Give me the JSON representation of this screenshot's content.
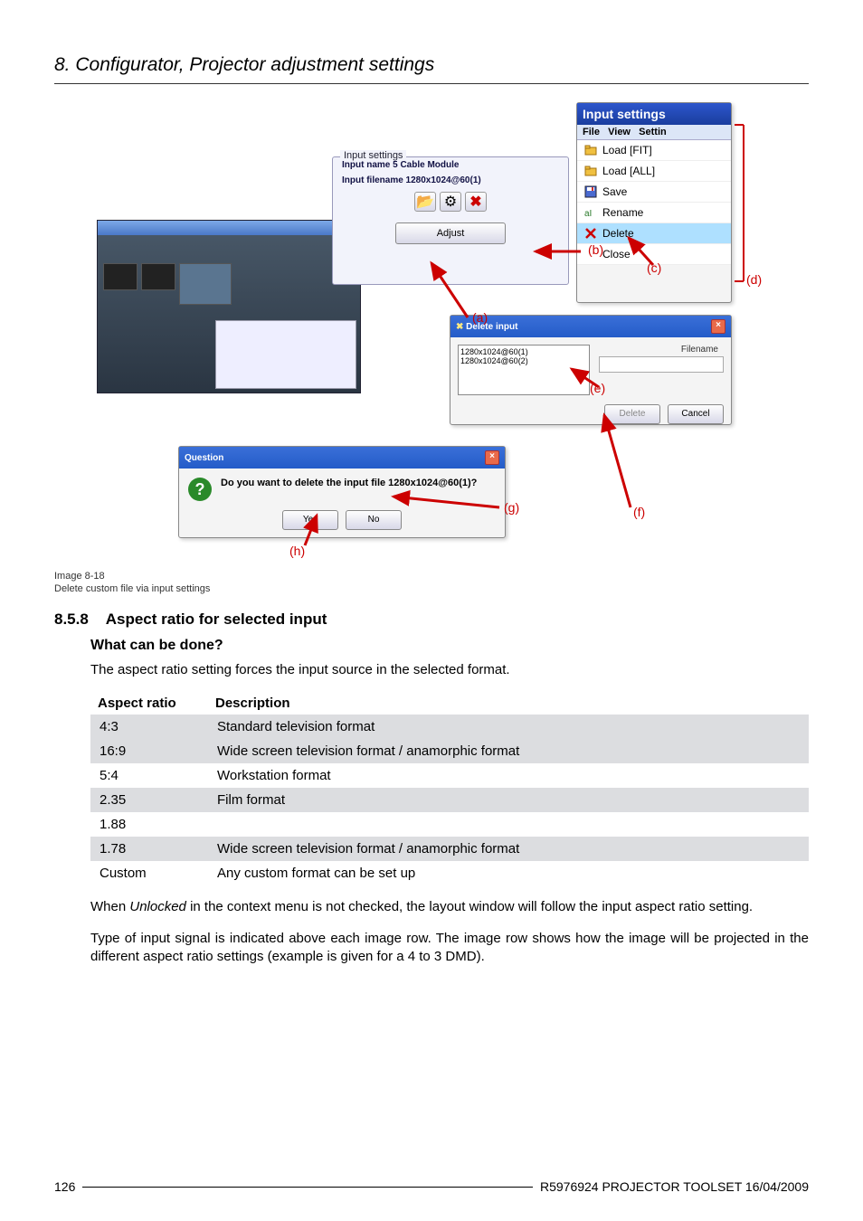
{
  "header": {
    "section": "8.  Configurator, Projector adjustment settings"
  },
  "figure": {
    "menu": {
      "title": "Input settings",
      "strip": [
        "File",
        "View",
        "Settin"
      ],
      "items": [
        {
          "icon": "load-fit-icon",
          "label": "Load [FIT]"
        },
        {
          "icon": "load-all-icon",
          "label": "Load [ALL]"
        },
        {
          "icon": "save-icon",
          "label": "Save"
        },
        {
          "icon": "rename-icon",
          "label": "Rename"
        },
        {
          "icon": "delete-icon",
          "label": "Delete",
          "hl": true
        },
        {
          "icon": "close-icon",
          "label": "Close"
        }
      ]
    },
    "group": {
      "legend": "Input settings",
      "row1": "Input name 5 Cable Module",
      "row2": "Input filename 1280x1024@60(1)",
      "adjust": "Adjust"
    },
    "delete_panel": {
      "title": "Delete input",
      "filename_label": "Filename",
      "list": [
        "1280x1024@60(1)",
        "1280x1024@60(2)"
      ],
      "btn_delete": "Delete",
      "btn_cancel": "Cancel"
    },
    "question": {
      "title": "Question",
      "text": "Do you want to delete the input file 1280x1024@60(1)?",
      "yes": "Yes",
      "no": "No"
    },
    "annotations": {
      "a": "(a)",
      "b": "(b)",
      "c": "(c)",
      "d": "(d)",
      "e": "(e)",
      "f": "(f)",
      "g": "(g)",
      "h": "(h)"
    }
  },
  "caption": {
    "l1": "Image 8-18",
    "l2": "Delete custom file via input settings"
  },
  "section": {
    "num": "8.5.8",
    "title": "Aspect ratio for selected input",
    "what": "What can be done?",
    "intro": "The aspect ratio setting forces the input source in the selected format."
  },
  "table": {
    "head": [
      "Aspect ratio",
      "Description"
    ],
    "rows": [
      {
        "r": "4:3",
        "d": "Standard television format",
        "shade": true
      },
      {
        "r": "16:9",
        "d": "Wide screen television format / anamorphic format",
        "shade": true
      },
      {
        "r": "5:4",
        "d": "Workstation format",
        "shade": false
      },
      {
        "r": "2.35",
        "d": "Film format",
        "shade": true
      },
      {
        "r": "1.88",
        "d": "",
        "shade": false
      },
      {
        "r": "1.78",
        "d": "Wide screen television format / anamorphic format",
        "shade": true
      },
      {
        "r": "Custom",
        "d": "Any custom format can be set up",
        "shade": false
      }
    ]
  },
  "body": {
    "p1a": "When ",
    "p1i": "Unlocked",
    "p1b": " in the context menu is not checked, the layout window will follow the input aspect ratio setting.",
    "p2": "Type of input signal is indicated above each image row.  The image row shows how the image will be projected in the different aspect ratio settings (example is given for a 4 to 3 DMD)."
  },
  "footer": {
    "page": "126",
    "doc": "R5976924  PROJECTOR TOOLSET  16/04/2009"
  }
}
